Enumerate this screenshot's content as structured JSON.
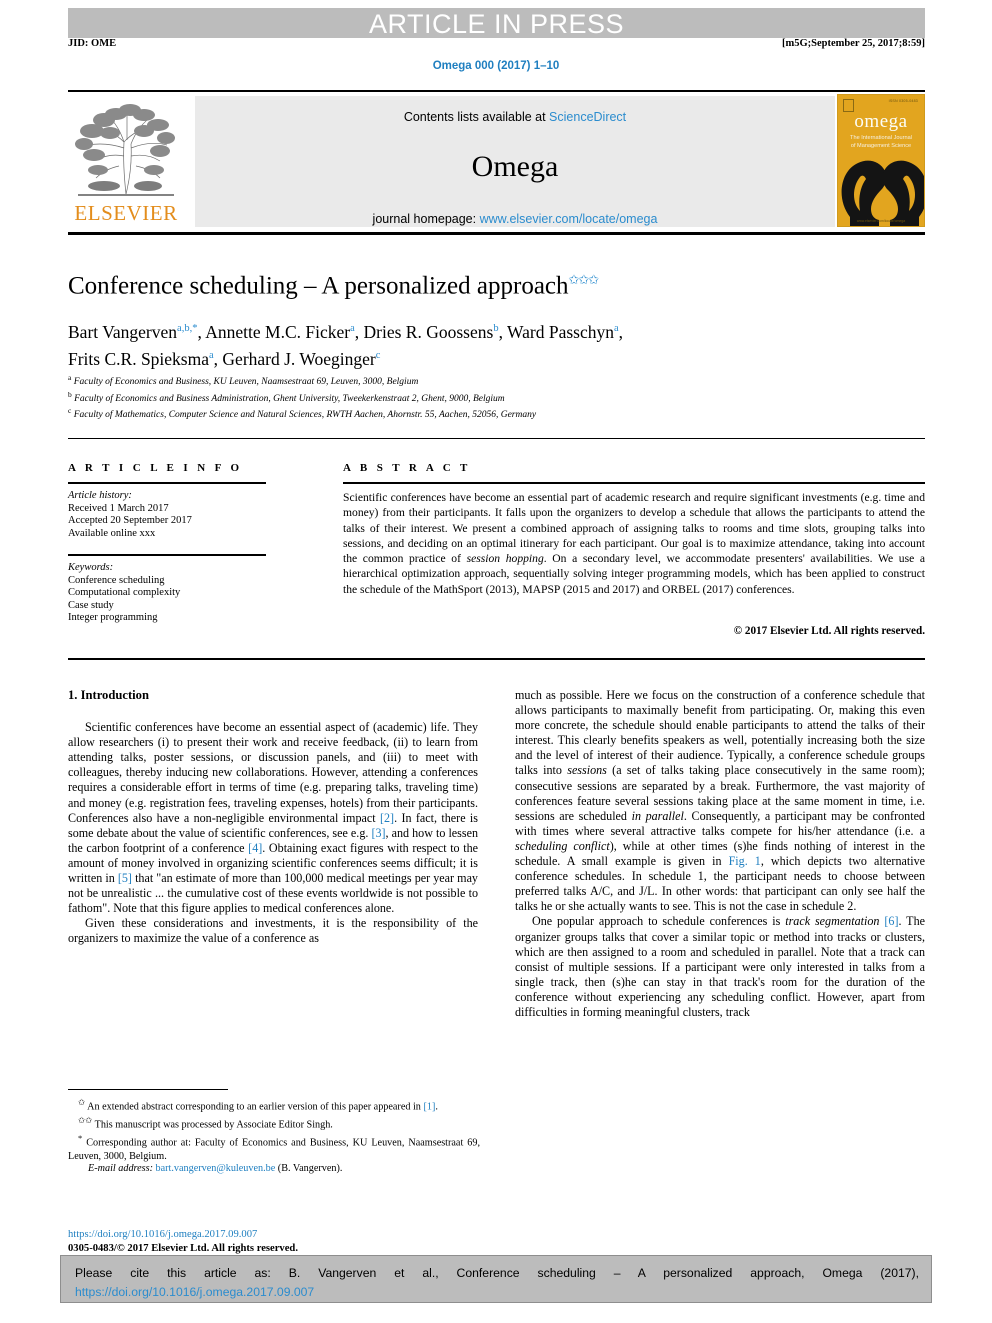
{
  "header": {
    "press_banner": "ARTICLE IN PRESS",
    "jid": "JID: OME",
    "stamp": "[m5G;September 25, 2017;8:59]",
    "running_head": "Omega 000 (2017) 1–10"
  },
  "banner": {
    "elsevier_wordmark": "ELSEVIER",
    "contents_prefix": "Contents lists available at ",
    "contents_link": "ScienceDirect",
    "journal_title": "Omega",
    "homepage_prefix": "journal homepage: ",
    "homepage_link": "www.elsevier.com/locate/omega",
    "cover": {
      "wordmark": "omega",
      "subtitle_line1": "The International Journal",
      "subtitle_line2": "of Management Science",
      "issn": "ISSN 0305-0483",
      "url": "www.elsevier.com/locate/omega"
    }
  },
  "article": {
    "title": "Conference scheduling – A personalized approach",
    "title_marks": "✩✩✩",
    "authors_line1": "Bart Vangerven",
    "authors": [
      {
        "name": "Bart Vangerven",
        "sup": "a,b,*"
      },
      {
        "name": "Annette M.C. Ficker",
        "sup": "a"
      },
      {
        "name": "Dries R. Goossens",
        "sup": "b"
      },
      {
        "name": "Ward Passchyn",
        "sup": "a"
      },
      {
        "name": "Frits C.R. Spieksma",
        "sup": "a"
      },
      {
        "name": "Gerhard J. Woeginger",
        "sup": "c"
      }
    ],
    "affiliations": [
      {
        "mark": "a",
        "text": "Faculty of Economics and Business, KU Leuven, Naamsestraat 69, Leuven, 3000, Belgium"
      },
      {
        "mark": "b",
        "text": "Faculty of Economics and Business Administration, Ghent University, Tweekerkenstraat 2, Ghent, 9000, Belgium"
      },
      {
        "mark": "c",
        "text": "Faculty of Mathematics, Computer Science and Natural Sciences, RWTH Aachen, Ahornstr. 55, Aachen, 52056, Germany"
      }
    ]
  },
  "article_info": {
    "heading": "A R T I C L E   I N F O",
    "history_label": "Article history:",
    "history": [
      "Received 1 March 2017",
      "Accepted 20 September 2017",
      "Available online xxx"
    ],
    "keywords_label": "Keywords:",
    "keywords": [
      "Conference scheduling",
      "Computational complexity",
      "Case study",
      "Integer programming"
    ]
  },
  "abstract": {
    "heading": "A B S T R A C T",
    "copyright": "© 2017 Elsevier Ltd. All rights reserved."
  },
  "body": {
    "section_heading": "1. Introduction"
  },
  "footnotes": {
    "doi_link": "https://doi.org/10.1016/j.omega.2017.09.007",
    "issn_line": "0305-0483/© 2017 Elsevier Ltd. All rights reserved.",
    "email_label": "E-mail address:",
    "email": "bart.vangerven@kuleuven.be",
    "email_attrib": "(B. Vangerven)."
  },
  "citation": {
    "text": "Please cite this article as: B. Vangerven et al., Conference scheduling – A personalized approach, Omega (2017),",
    "doi": "https://doi.org/10.1016/j.omega.2017.09.007"
  },
  "colors": {
    "link": "#1f7fc0",
    "banner_gray": "#bcbcbc",
    "elsevier_orange": "#e38d1c",
    "cover_gold": "#e2a51f"
  }
}
